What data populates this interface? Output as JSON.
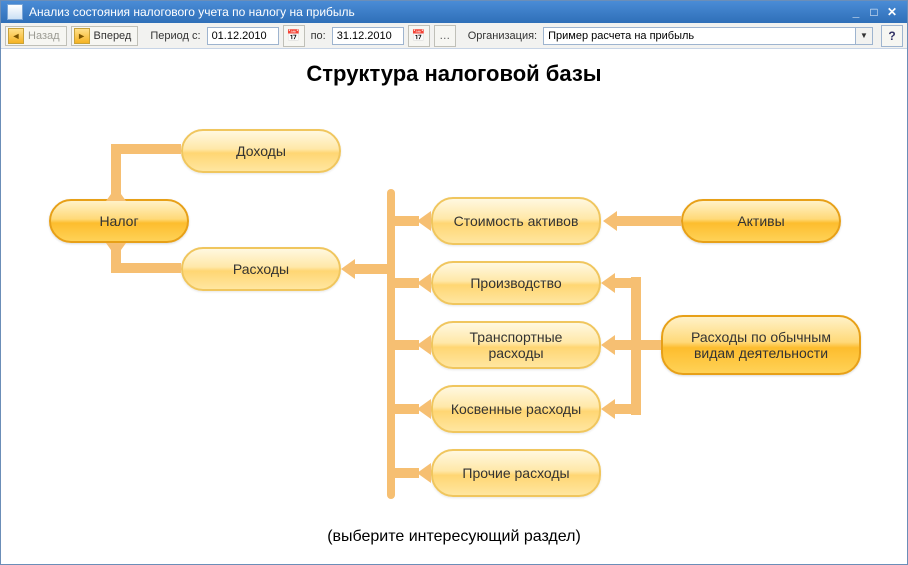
{
  "window": {
    "title": "Анализ состояния налогового учета по налогу на прибыль"
  },
  "toolbar": {
    "back": "Назад",
    "forward": "Вперед",
    "period_from_label": "Период с:",
    "period_from_value": "01.12.2010",
    "period_to_label": "по:",
    "period_to_value": "31.12.2010",
    "org_label": "Организация:",
    "org_value": "Пример расчета на прибыль",
    "help": "?"
  },
  "diagram": {
    "title": "Структура налоговой базы",
    "footer": "(выберите интересующий раздел)",
    "nodes": {
      "tax": "Налог",
      "income": "Доходы",
      "expenses": "Расходы",
      "asset_cost": "Стоимость активов",
      "production": "Производство",
      "transport": "Транспортные расходы",
      "indirect": "Косвенные расходы",
      "other": "Прочие расходы",
      "assets": "Активы",
      "ord_expenses": "Расходы по обычным видам деятельности"
    }
  }
}
